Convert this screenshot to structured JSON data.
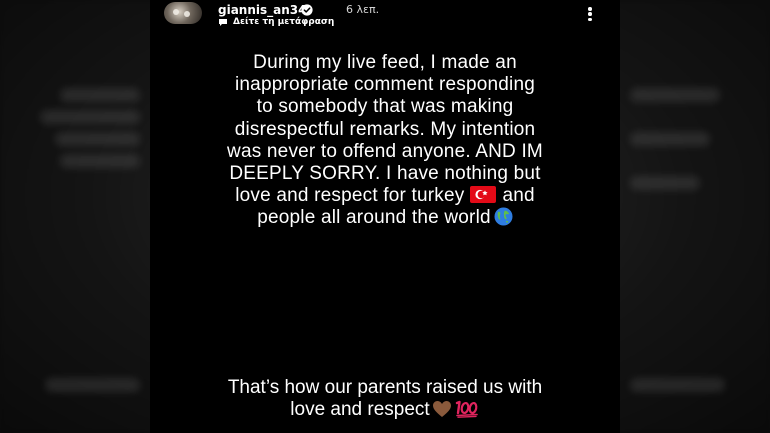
{
  "story": {
    "username": "giannis_an34",
    "time_ago": "6 λεπ.",
    "translate_label": "Δείτε τη μετάφραση",
    "icons": {
      "verified": "verified-badge-icon",
      "translate": "translate-bubble-icon",
      "more": "more-vertical-icon",
      "flag": "turkey-flag-emoji",
      "globe": "globe-emoji",
      "heart": "brown-heart-emoji",
      "hundred": "hundred-points-emoji"
    }
  },
  "message": {
    "line1": "During my live feed, I made an",
    "line2": "inappropriate comment responding",
    "line3": "to somebody that was making",
    "line4": "disrespectful remarks. My intention",
    "line5": "was never to offend anyone. AND IM",
    "line6": "DEEPLY SORRY. I have nothing but",
    "line7a": "love and respect for turkey",
    "line7b": "and",
    "line8": "people all around the world"
  },
  "footer": {
    "line1": "That’s how our parents raised us with",
    "line2": "love and respect"
  },
  "colors": {
    "story_background": "#000000",
    "text": "#ffffff",
    "flag_red": "#e30a17",
    "verified_blue": "#3897f0",
    "heart_brown": "#8a5a3c",
    "hundred_red": "#e0245e"
  }
}
